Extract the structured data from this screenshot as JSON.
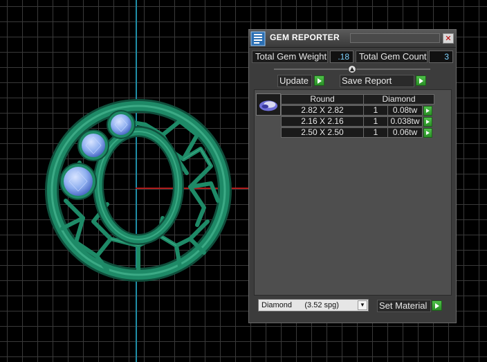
{
  "panel": {
    "title": "GEM REPORTER",
    "close_glyph": "✕",
    "total_gem_weight_label": "Total Gem Weight",
    "total_gem_weight_value": ".18",
    "total_gem_count_label": "Total Gem Count",
    "total_gem_count_value": "3",
    "update_label": "Update",
    "save_report_label": "Save Report",
    "table": {
      "headers": [
        "Round",
        "Diamond"
      ],
      "rows": [
        {
          "size": "2.82 X 2.82",
          "qty": "1",
          "weight": "0.08tw"
        },
        {
          "size": "2.16 X 2.16",
          "qty": "1",
          "weight": "0.038tw"
        },
        {
          "size": "2.50 X 2.50",
          "qty": "1",
          "weight": "0.06tw"
        }
      ]
    },
    "material_select": "Diamond      (3.52 spg)",
    "set_material_label": "Set Material"
  },
  "icons": {
    "title": "gem-reporter-icon",
    "close": "close-icon",
    "play": "green-arrow-icon",
    "dropdown": "chevron-down-icon",
    "gem": "round-gem-icon"
  },
  "colors": {
    "model": "#1e8a67",
    "gem": "#8fb0f0",
    "axis_y": "#1f8fa8",
    "axis_x": "#b01a1a",
    "value_text": "#7fd4ff"
  }
}
